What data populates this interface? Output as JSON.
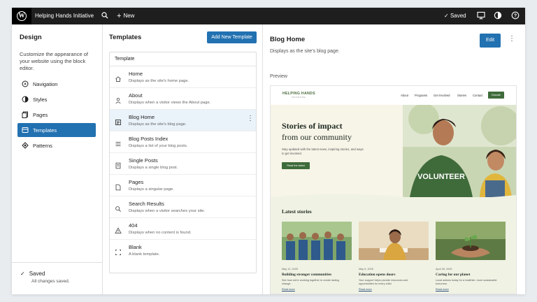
{
  "topbar": {
    "site_title": "Helping Hands Initiative",
    "new_label": "New",
    "saved_label": "Saved"
  },
  "sidebar": {
    "title": "Design",
    "description": "Customize the appearance of your website using the block editor.",
    "items": [
      {
        "label": "Navigation",
        "icon": "navigation-icon"
      },
      {
        "label": "Styles",
        "icon": "styles-icon"
      },
      {
        "label": "Pages",
        "icon": "pages-icon"
      },
      {
        "label": "Templates",
        "icon": "templates-icon",
        "active": true
      },
      {
        "label": "Patterns",
        "icon": "patterns-icon"
      }
    ],
    "saved_title": "Saved",
    "saved_sub": "All changes saved."
  },
  "templates": {
    "title": "Templates",
    "add_button": "Add New Template",
    "list_header": "Template",
    "rows": [
      {
        "name": "Home",
        "desc": "Displays as the site's home page.",
        "icon": "home-icon"
      },
      {
        "name": "About",
        "desc": "Displays when a visitor views the About page.",
        "icon": "person-icon"
      },
      {
        "name": "Blog Home",
        "desc": "Displays as the site's blog page.",
        "icon": "blog-icon",
        "selected": true
      },
      {
        "name": "Blog Posts Index",
        "desc": "Displays a list of your blog posts.",
        "icon": "list-icon"
      },
      {
        "name": "Single Posts",
        "desc": "Displays a single blog post.",
        "icon": "post-icon"
      },
      {
        "name": "Pages",
        "desc": "Displays a singular page.",
        "icon": "page-icon"
      },
      {
        "name": "Search Results",
        "desc": "Displays when a visitor searches your site.",
        "icon": "search-icon"
      },
      {
        "name": "404",
        "desc": "Displays when no content is found.",
        "icon": "warning-icon"
      },
      {
        "name": "Blank",
        "desc": "A blank template.",
        "icon": "blank-icon"
      }
    ]
  },
  "preview": {
    "title": "Blog Home",
    "description": "Displays as the site's blog page.",
    "edit_label": "Edit",
    "preview_label": "Preview",
    "site": {
      "logo": "HELPING HANDS",
      "logo_sub": "INITIATIVE",
      "nav": [
        "About",
        "Programs",
        "Get Involved",
        "Stories",
        "Contact"
      ],
      "donate": "Donate",
      "hero_line1": "Stories of impact",
      "hero_line2": "from our community",
      "hero_text": "Stay updated with the latest news, inspiring stories, and ways to get involved.",
      "hero_button": "Read the latest",
      "latest_title": "Latest stories",
      "cards": [
        {
          "date": "May 12, 2025",
          "title": "Building stronger communities",
          "text": "See how we're working together to create lasting change.",
          "link": "Read more"
        },
        {
          "date": "May 5, 2025",
          "title": "Education opens doors",
          "text": "Your support helps provide resources and opportunities for every child.",
          "link": "Read more"
        },
        {
          "date": "April 28, 2025",
          "title": "Caring for our planet",
          "text": "Local actions today for a healthier, more sustainable tomorrow.",
          "link": "Read more"
        }
      ],
      "shirt_text": "VOLUNTEER"
    }
  },
  "colors": {
    "accent": "#2271b1",
    "topbar": "#1e1e1e",
    "brand_green": "#3e6b3a"
  }
}
